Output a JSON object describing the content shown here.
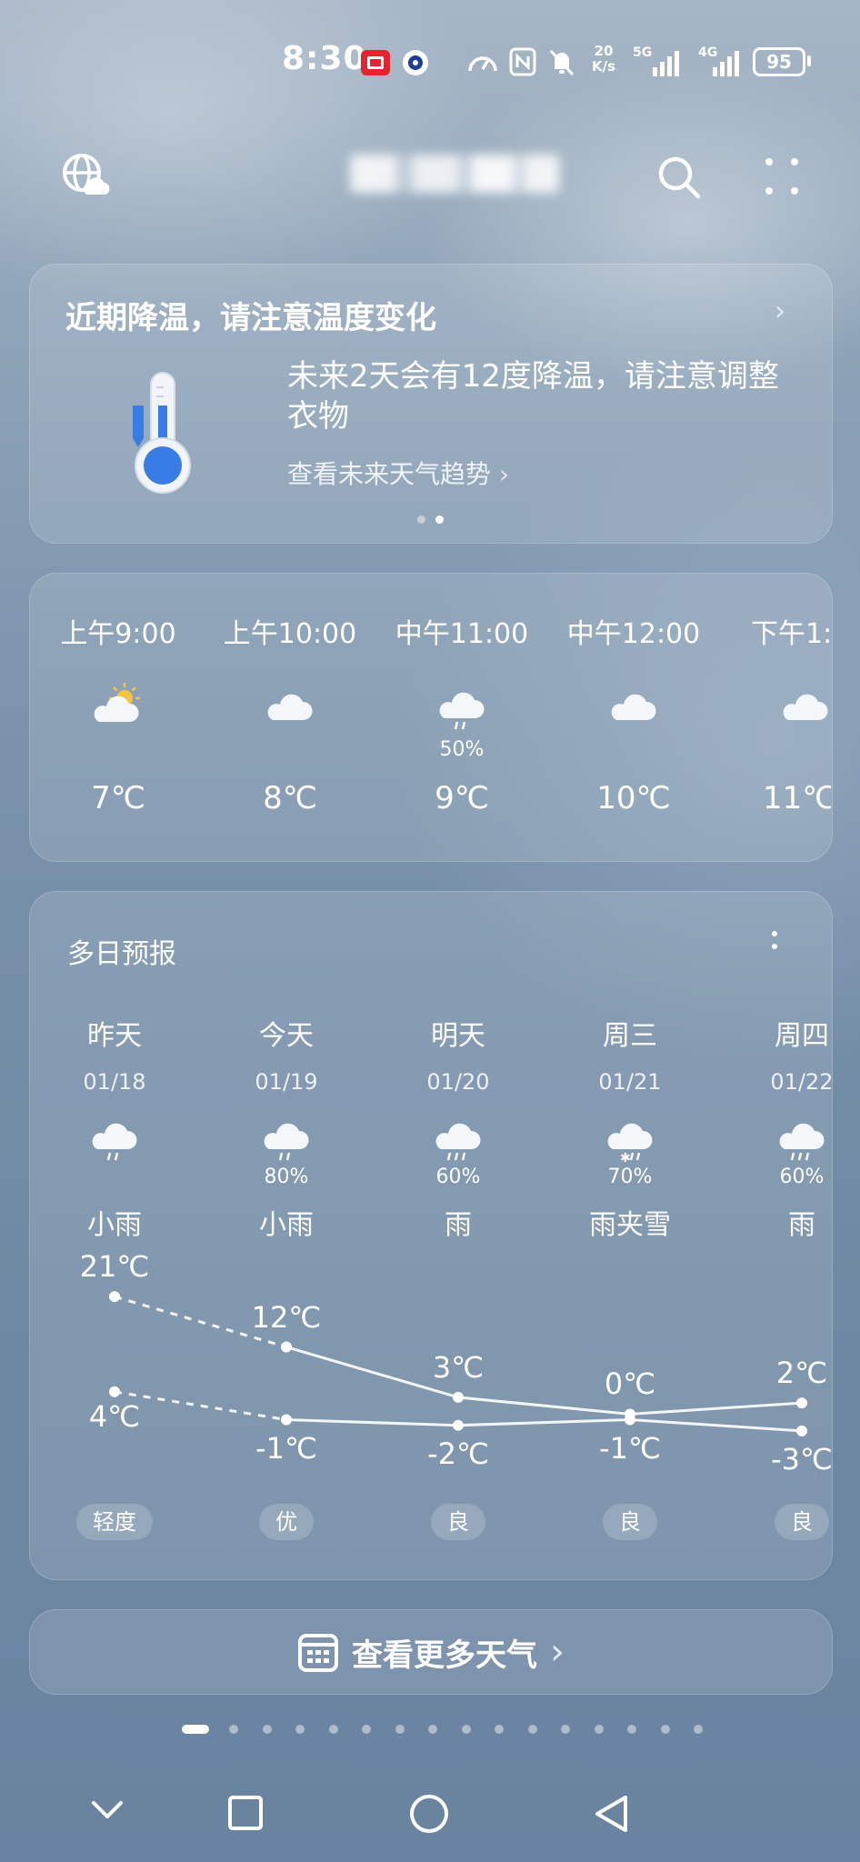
{
  "status_bar": {
    "time": "8:30",
    "speed_top": "20",
    "speed_unit": "K/s",
    "net1": "5G",
    "net2": "4G",
    "battery": "95"
  },
  "header": {
    "icons": [
      "globe-cloud-icon",
      "search-icon",
      "more-icon"
    ]
  },
  "alert_card": {
    "title": "近期降温，请注意温度变化",
    "body": "未来2天会有12度降温，请注意调整衣物",
    "link": "查看未来天气趋势",
    "page_count": 2,
    "active_page": 1
  },
  "hourly": [
    {
      "time": "上午9:00",
      "icon": "partly-sunny-icon",
      "prob": "",
      "temp": "7℃"
    },
    {
      "time": "上午10:00",
      "icon": "cloudy-icon",
      "prob": "",
      "temp": "8℃"
    },
    {
      "time": "中午11:00",
      "icon": "rain-cloud-icon",
      "prob": "50%",
      "temp": "9℃"
    },
    {
      "time": "中午12:00",
      "icon": "cloudy-icon",
      "prob": "",
      "temp": "10℃"
    },
    {
      "time": "下午1:",
      "icon": "cloudy-icon",
      "prob": "",
      "temp": "11℃"
    }
  ],
  "daily": {
    "title": "多日预报",
    "days": [
      {
        "name": "昨天",
        "date": "01/18",
        "icon": "light-rain-icon",
        "prob": "",
        "cond": "小雨",
        "high": "21℃",
        "low": "4℃",
        "aqi": "轻度"
      },
      {
        "name": "今天",
        "date": "01/19",
        "icon": "light-rain-icon",
        "prob": "80%",
        "cond": "小雨",
        "high": "12℃",
        "low": "-1℃",
        "aqi": "优"
      },
      {
        "name": "明天",
        "date": "01/20",
        "icon": "rain-icon",
        "prob": "60%",
        "cond": "雨",
        "high": "3℃",
        "low": "-2℃",
        "aqi": "良"
      },
      {
        "name": "周三",
        "date": "01/21",
        "icon": "sleet-icon",
        "prob": "70%",
        "cond": "雨夹雪",
        "high": "0℃",
        "low": "-1℃",
        "aqi": "良"
      },
      {
        "name": "周四",
        "date": "01/22",
        "icon": "rain-icon",
        "prob": "60%",
        "cond": "雨",
        "high": "2℃",
        "low": "-3℃",
        "aqi": "良"
      }
    ]
  },
  "more_button": {
    "label": "查看更多天气"
  },
  "page_indicator": {
    "count": 16,
    "active": 0
  },
  "nav_bar": {
    "icons": [
      "chevron-down-icon",
      "recents-square-icon",
      "home-circle-icon",
      "back-triangle-icon"
    ]
  }
}
